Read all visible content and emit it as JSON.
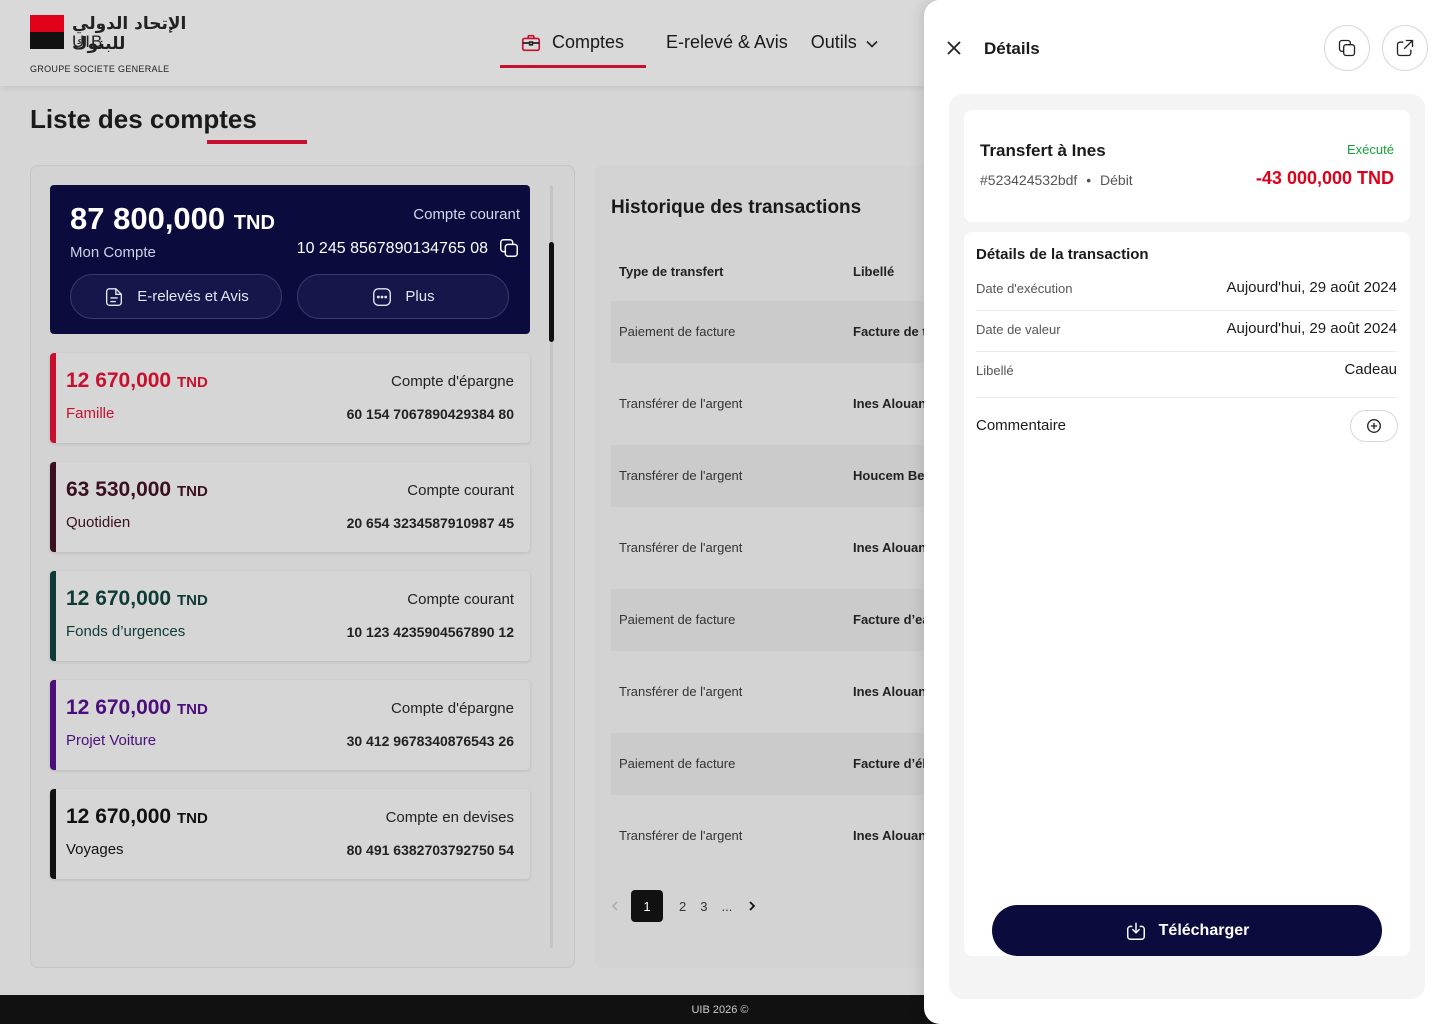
{
  "brand": {
    "arabic_name": "الإتحاد الدولي للبنوك",
    "short_name": "UIB",
    "group": "GROUPE SOCIETE GENERALE",
    "colors": {
      "red": "#e0001a",
      "navy": "#0b0b3d"
    }
  },
  "nav": {
    "items": [
      {
        "label": "Comptes",
        "icon": "briefcase-icon",
        "active": true
      },
      {
        "label": "E-relevé & Avis"
      },
      {
        "label": "Outils",
        "icon": "chevron-down-icon"
      }
    ]
  },
  "page": {
    "title": "Liste des comptes"
  },
  "main_account": {
    "amount": "87 800,000",
    "currency": "TND",
    "name": "Mon Compte",
    "type": "Compte courant",
    "number": "10 245 8567890134765 08",
    "buttons": [
      {
        "label": "E-relevés et Avis",
        "icon": "document-icon"
      },
      {
        "label": "Plus",
        "icon": "more-icon"
      }
    ]
  },
  "accounts": [
    {
      "amount": "12 670,000",
      "currency": "TND",
      "name": "Famille",
      "type": "Compte d'épargne",
      "number": "60 154 7067890429384 80",
      "color": "#c8102e"
    },
    {
      "amount": "63 530,000",
      "currency": "TND",
      "name": "Quotidien",
      "type": "Compte courant",
      "number": "20 654 3234587910987 45",
      "color": "#3a1020"
    },
    {
      "amount": "12 670,000",
      "currency": "TND",
      "name": "Fonds d’urgences",
      "type": "Compte courant",
      "number": "10 123 4235904567890 12",
      "color": "#0f3a38"
    },
    {
      "amount": "12 670,000",
      "currency": "TND",
      "name": "Projet Voiture",
      "type": "Compte d'épargne",
      "number": "30 412 9678340876543 26",
      "color": "#4a0f7a"
    },
    {
      "amount": "12 670,000",
      "currency": "TND",
      "name": "Voyages",
      "type": "Compte en devises",
      "number": "80 491 6382703792750 54",
      "color": "#111111"
    }
  ],
  "transactions": {
    "title": "Historique des transactions",
    "columns": [
      "Type de transfert",
      "Libellé"
    ],
    "rows": [
      {
        "type": "Paiement de facture",
        "label": "Facture de t"
      },
      {
        "type": "Transférer de l'argent",
        "label": "Ines Alouani"
      },
      {
        "type": "Transférer de l'argent",
        "label": "Houcem Ben"
      },
      {
        "type": "Transférer de l'argent",
        "label": "Ines Alouani"
      },
      {
        "type": "Paiement de facture",
        "label": "Facture d’ea"
      },
      {
        "type": "Transférer de l'argent",
        "label": "Ines Alouani"
      },
      {
        "type": "Paiement de facture",
        "label": "Facture d’élé"
      },
      {
        "type": "Transférer de l'argent",
        "label": "Ines Alouani"
      }
    ],
    "pagination": {
      "pages": [
        "1",
        "2",
        "3",
        "..."
      ],
      "current": "1"
    }
  },
  "footer": {
    "text": "UIB 2026 ©"
  },
  "drawer": {
    "title": "Détails",
    "summary": {
      "title": "Transfert à Ines",
      "status": "Exécuté",
      "status_color": "#1a9e3d",
      "reference": "#523424532bdf",
      "separator": "•",
      "direction": "Débit",
      "amount": "-43 000,000 TND"
    },
    "details": {
      "title": "Détails de la transaction",
      "rows": [
        {
          "label": "Date d'exécution",
          "value": "Aujourd'hui, 29 août 2024"
        },
        {
          "label": "Date de valeur",
          "value": "Aujourd'hui, 29 août 2024"
        },
        {
          "label": "Libellé",
          "value": "Cadeau"
        }
      ],
      "comment_label": "Commentaire"
    },
    "download_label": "Télécharger"
  }
}
